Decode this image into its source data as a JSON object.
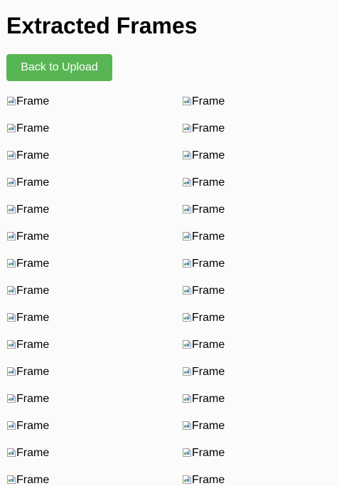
{
  "page": {
    "title": "Extracted Frames",
    "back_button_label": "Back to Upload"
  },
  "frames": [
    {
      "alt": "Frame"
    },
    {
      "alt": "Frame"
    },
    {
      "alt": "Frame"
    },
    {
      "alt": "Frame"
    },
    {
      "alt": "Frame"
    },
    {
      "alt": "Frame"
    },
    {
      "alt": "Frame"
    },
    {
      "alt": "Frame"
    },
    {
      "alt": "Frame"
    },
    {
      "alt": "Frame"
    },
    {
      "alt": "Frame"
    },
    {
      "alt": "Frame"
    },
    {
      "alt": "Frame"
    },
    {
      "alt": "Frame"
    },
    {
      "alt": "Frame"
    },
    {
      "alt": "Frame"
    },
    {
      "alt": "Frame"
    },
    {
      "alt": "Frame"
    },
    {
      "alt": "Frame"
    },
    {
      "alt": "Frame"
    },
    {
      "alt": "Frame"
    },
    {
      "alt": "Frame"
    },
    {
      "alt": "Frame"
    },
    {
      "alt": "Frame"
    },
    {
      "alt": "Frame"
    },
    {
      "alt": "Frame"
    },
    {
      "alt": "Frame"
    },
    {
      "alt": "Frame"
    },
    {
      "alt": "Frame"
    },
    {
      "alt": "Frame"
    }
  ],
  "colors": {
    "button_bg": "#58b553",
    "page_bg": "#fbfbfb"
  }
}
